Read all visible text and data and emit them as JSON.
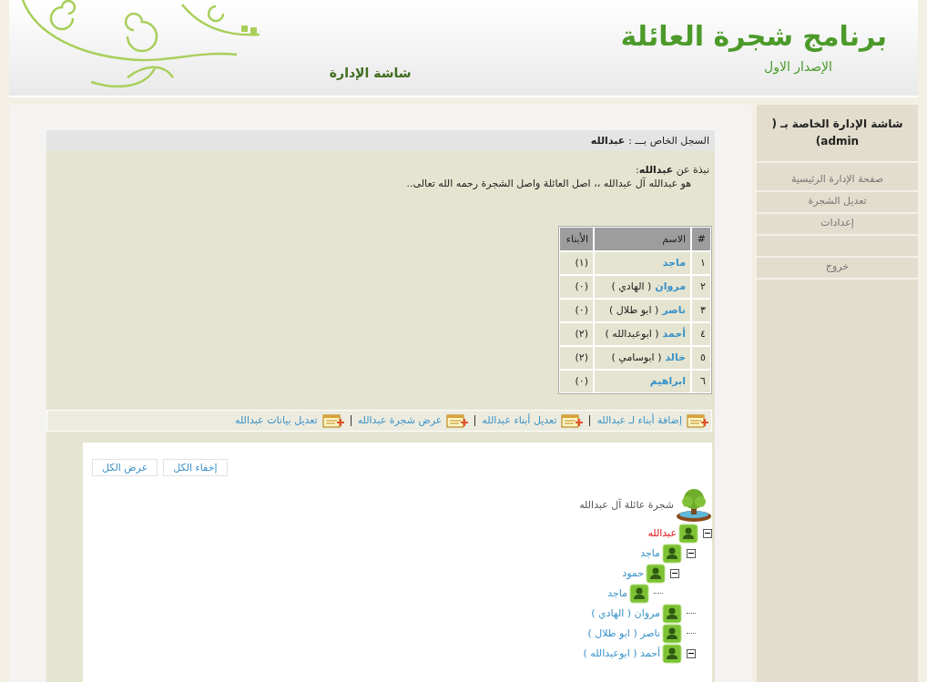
{
  "header": {
    "title": "برنامج شجرة العائلة",
    "version": "الإصدار الاول",
    "screen_name": "شاشة الإدارة"
  },
  "sidebar": {
    "title": "شاشة الإدارة الخاصة بـ ( admin)",
    "groups": [
      [
        {
          "label": "صفحة الإدارة الرئيسية"
        },
        {
          "label": "تعديل الشجرة"
        },
        {
          "label": "إعدادات"
        }
      ],
      [
        {
          "label": "خروج"
        }
      ]
    ]
  },
  "record": {
    "heading": "السجل الخاص بـــ :",
    "person": "عبدالله",
    "bio_title": "نبذة عن **عبدالله**:",
    "bio": "هو عبدالله آل عبدالله ،، اصل العائلة واصل الشجرة رحمه الله تعالى..",
    "table": {
      "columns": [
        "#",
        "الاسم",
        "الأبناء"
      ],
      "rows": [
        {
          "num": "١",
          "name": "ماجد",
          "count": "(١)"
        },
        {
          "num": "٢",
          "name": "مروان",
          "nickname": "( الهادي )",
          "count": "(٠)"
        },
        {
          "num": "٣",
          "name": "ناصر",
          "nickname": "( ابو طلال )",
          "count": "(٠)"
        },
        {
          "num": "٤",
          "name": "أحمد",
          "nickname": "( ابوعبدالله )",
          "count": "(٢)"
        },
        {
          "num": "٥",
          "name": "خالد",
          "nickname": "( ابوسامي )",
          "count": "(٢)"
        },
        {
          "num": "٦",
          "name": "ابراهيم",
          "count": "(٠)"
        }
      ]
    },
    "actions": [
      "إضافة أبناء لـ عبدالله",
      "تعديل أبناء عبدالله",
      "عرض شجرة عبدالله",
      "تعديل بيانات عبدالله"
    ]
  },
  "tree_panel": {
    "buttons": [
      "إخفاء الكل",
      "عرض الكل"
    ],
    "title": "شجرة عائلة آل عبدالله",
    "nodes": [
      {
        "name": "عبدالله",
        "current": true,
        "expanded": true,
        "children": [
          {
            "name": "ماجد",
            "current": false,
            "expanded": true,
            "children": [
              {
                "name": "حمود",
                "current": false,
                "expanded": true,
                "children": [
                  {
                    "name": "ماجد",
                    "current": false
                  }
                ]
              }
            ]
          },
          {
            "name": "مروان ( الهادي )",
            "current": false
          },
          {
            "name": "ناصر ( ابو طلال )",
            "current": false
          },
          {
            "name": "أحمد ( ابوعبدالله )",
            "current": false,
            "expanded": true
          }
        ]
      }
    ]
  }
}
